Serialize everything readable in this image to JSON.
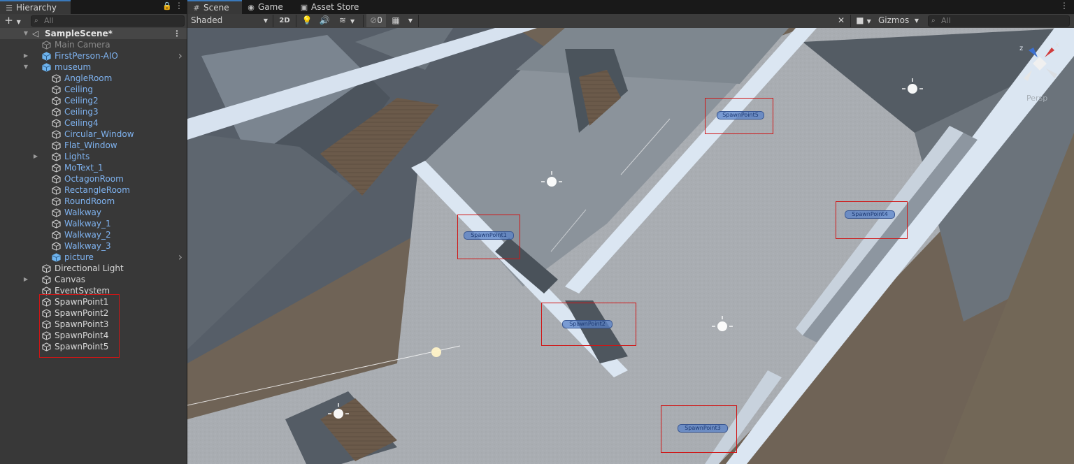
{
  "hierarchy": {
    "tab_label": "Hierarchy",
    "search_placeholder": "All",
    "scene_name": "SampleScene*",
    "items": [
      {
        "label": "Main Camera",
        "style": "gray",
        "depth": 1,
        "icon": "cube-icon"
      },
      {
        "label": "FirstPerson-AIO",
        "style": "blue",
        "depth": 1,
        "icon": "prefab-icon",
        "expandable": true
      },
      {
        "label": "museum",
        "style": "blue",
        "depth": 1,
        "icon": "prefab-icon",
        "expanded": true
      },
      {
        "label": "AngleRoom",
        "style": "blue",
        "depth": 2,
        "icon": "cube-icon"
      },
      {
        "label": "Ceiling",
        "style": "blue",
        "depth": 2,
        "icon": "cube-icon"
      },
      {
        "label": "Ceiling2",
        "style": "blue",
        "depth": 2,
        "icon": "cube-icon"
      },
      {
        "label": "Ceiling3",
        "style": "blue",
        "depth": 2,
        "icon": "cube-icon"
      },
      {
        "label": "Ceiling4",
        "style": "blue",
        "depth": 2,
        "icon": "cube-icon"
      },
      {
        "label": "Circular_Window",
        "style": "blue",
        "depth": 2,
        "icon": "cube-icon"
      },
      {
        "label": "Flat_Window",
        "style": "blue",
        "depth": 2,
        "icon": "cube-icon"
      },
      {
        "label": "Lights",
        "style": "blue",
        "depth": 2,
        "icon": "cube-icon",
        "expandable": true
      },
      {
        "label": "MoText_1",
        "style": "blue",
        "depth": 2,
        "icon": "cube-icon"
      },
      {
        "label": "OctagonRoom",
        "style": "blue",
        "depth": 2,
        "icon": "cube-icon"
      },
      {
        "label": "RectangleRoom",
        "style": "blue",
        "depth": 2,
        "icon": "cube-icon"
      },
      {
        "label": "RoundRoom",
        "style": "blue",
        "depth": 2,
        "icon": "cube-icon"
      },
      {
        "label": "Walkway",
        "style": "blue",
        "depth": 2,
        "icon": "cube-icon"
      },
      {
        "label": "Walkway_1",
        "style": "blue",
        "depth": 2,
        "icon": "cube-icon"
      },
      {
        "label": "Walkway_2",
        "style": "blue",
        "depth": 2,
        "icon": "cube-icon"
      },
      {
        "label": "Walkway_3",
        "style": "blue",
        "depth": 2,
        "icon": "cube-icon"
      },
      {
        "label": "picture",
        "style": "blue",
        "depth": 2,
        "icon": "prefab-icon"
      },
      {
        "label": "Directional Light",
        "style": "white",
        "depth": 1,
        "icon": "cube-icon"
      },
      {
        "label": "Canvas",
        "style": "white",
        "depth": 1,
        "icon": "cube-icon",
        "expandable": true
      },
      {
        "label": "EventSystem",
        "style": "white",
        "depth": 1,
        "icon": "cube-icon"
      },
      {
        "label": "SpawnPoint1",
        "style": "white",
        "depth": 1,
        "icon": "cube-icon"
      },
      {
        "label": "SpawnPoint2",
        "style": "white",
        "depth": 1,
        "icon": "cube-icon"
      },
      {
        "label": "SpawnPoint3",
        "style": "white",
        "depth": 1,
        "icon": "cube-icon"
      },
      {
        "label": "SpawnPoint4",
        "style": "white",
        "depth": 1,
        "icon": "cube-icon"
      },
      {
        "label": "SpawnPoint5",
        "style": "white",
        "depth": 1,
        "icon": "cube-icon"
      }
    ]
  },
  "tabs": {
    "scene": "Scene",
    "game": "Game",
    "asset_store": "Asset Store"
  },
  "scene_toolbar": {
    "shading_mode": "Shaded",
    "mode_2d": "2D",
    "hidden_count": "0",
    "gizmos": "Gizmos",
    "search_placeholder": "All"
  },
  "scene_view": {
    "projection_label": "Persp",
    "axis_z": "z",
    "axis_x": "x",
    "spawn_points": [
      "SpawnPoint1",
      "SpawnPoint2",
      "SpawnPoint3",
      "SpawnPoint4",
      "SpawnPoint5"
    ]
  },
  "colors": {
    "highlight_box": "#d01515",
    "hierarchy_blue": "#7fb3f0",
    "tab_accent": "#3a79bb"
  }
}
